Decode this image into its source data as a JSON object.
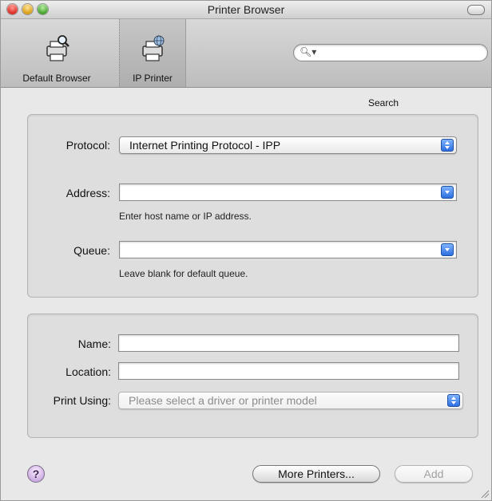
{
  "window": {
    "title": "Printer Browser"
  },
  "toolbar": {
    "default_browser_label": "Default Browser",
    "ip_printer_label": "IP Printer",
    "search_label": "Search",
    "search_value": ""
  },
  "protocol": {
    "label": "Protocol:",
    "value": "Internet Printing Protocol - IPP"
  },
  "address": {
    "label": "Address:",
    "value": "",
    "hint": "Enter host name or IP address."
  },
  "queue": {
    "label": "Queue:",
    "value": "",
    "hint": "Leave blank for default queue."
  },
  "name": {
    "label": "Name:",
    "value": ""
  },
  "location": {
    "label": "Location:",
    "value": ""
  },
  "print_using": {
    "label": "Print Using:",
    "value": "Please select a driver or printer model"
  },
  "buttons": {
    "help": "?",
    "more_printers": "More Printers...",
    "add": "Add"
  },
  "colors": {
    "selected_toolbar_item": "#b8b8b8",
    "stepper_blue": "#2c6fe0"
  }
}
